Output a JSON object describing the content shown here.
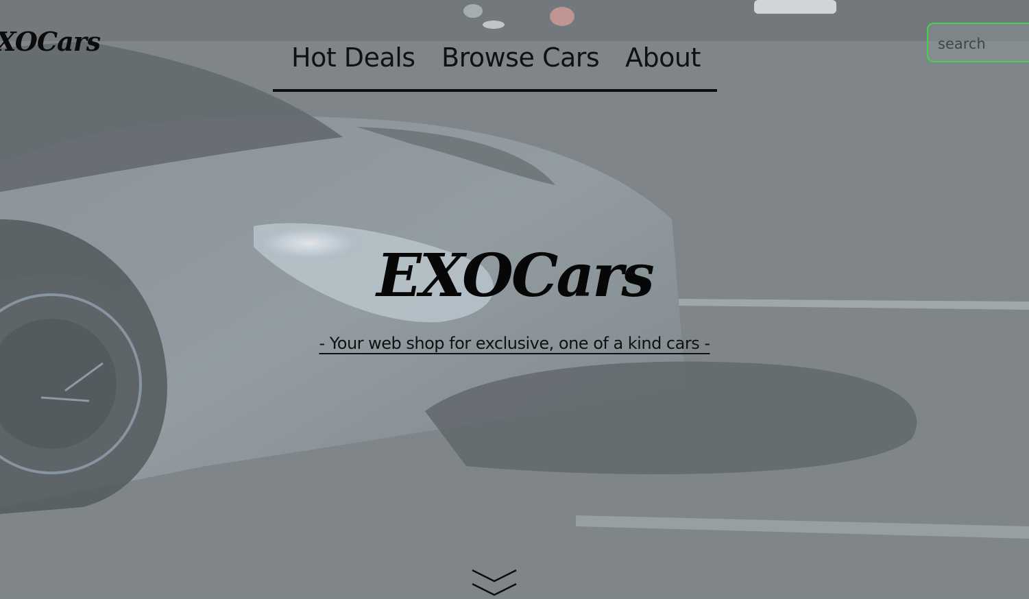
{
  "brand": {
    "corner_logo": "EXOCars"
  },
  "nav": {
    "items": [
      {
        "label": "Hot Deals"
      },
      {
        "label": "Browse Cars"
      },
      {
        "label": "About"
      }
    ]
  },
  "search": {
    "placeholder": "search",
    "value": "",
    "border_color": "#3fd64a"
  },
  "hero": {
    "title": "EXOCars",
    "tagline": "- Your web shop for exclusive, one of a kind cars -",
    "background": "sports-car-night-photo",
    "scroll_icon": "double-chevron-down-icon"
  }
}
